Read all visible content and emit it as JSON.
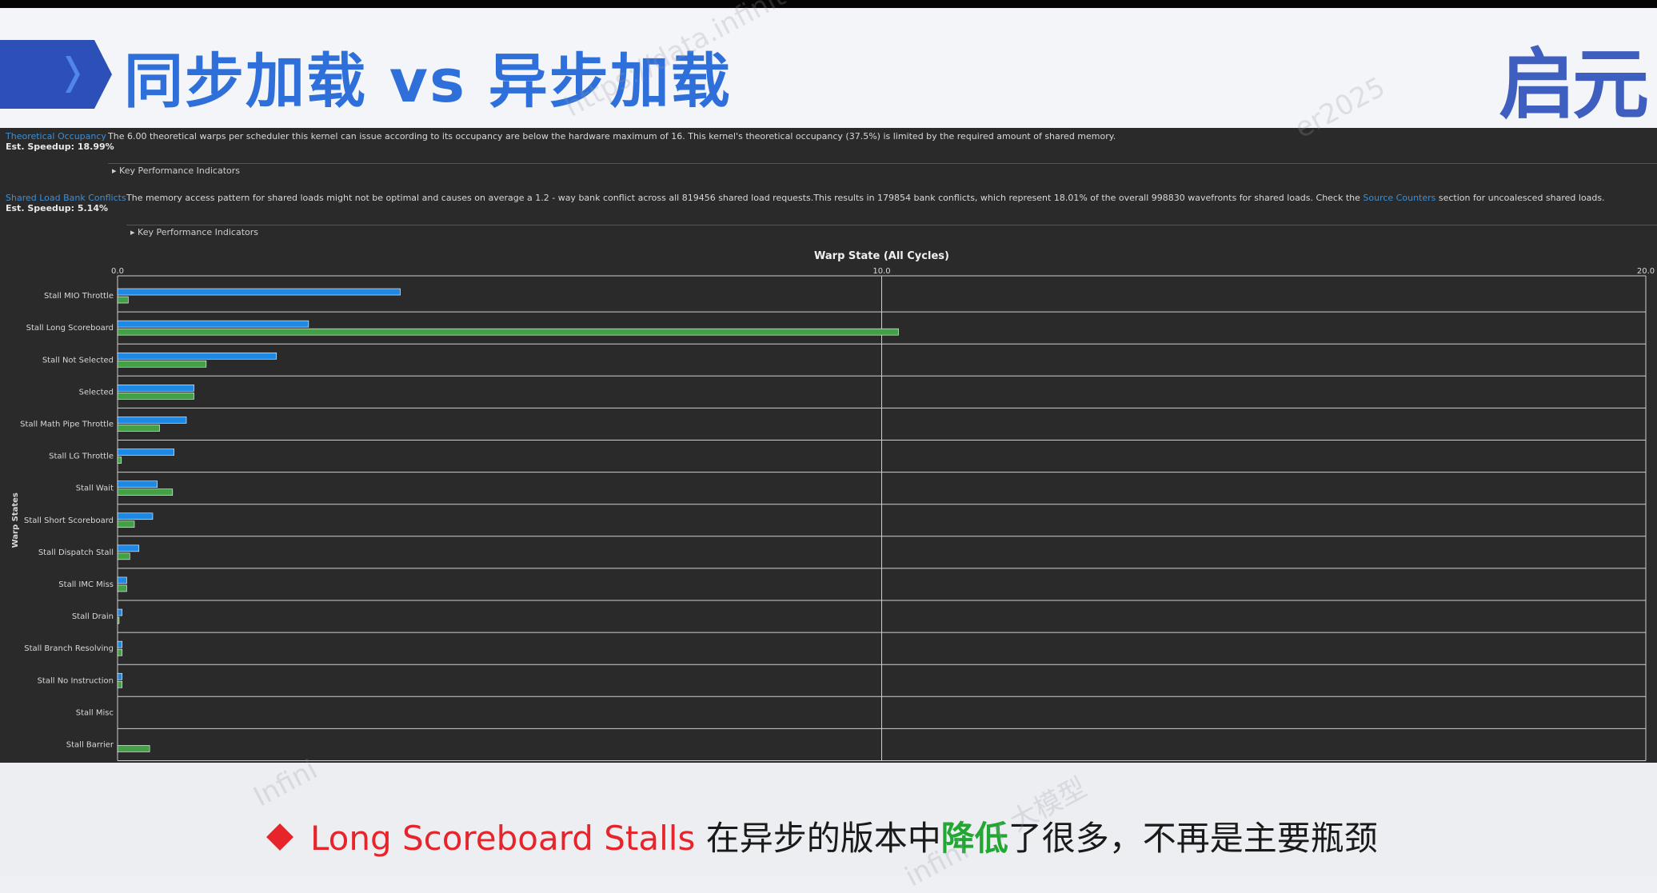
{
  "header": {
    "title": "同步加载 vs 异步加载",
    "logo": "启元"
  },
  "notes": [
    {
      "link": "Theoretical Occupancy",
      "speedup": "Est. Speedup: 18.99%",
      "text": "The 6.00 theoretical warps per scheduler this kernel can issue according to its occupancy are below the hardware maximum of 16. This kernel's theoretical occupancy (37.5%) is limited by the required amount of shared memory.",
      "kpi": "Key Performance Indicators"
    },
    {
      "link": "Shared Load Bank Conflicts",
      "speedup": "Est. Speedup: 5.14%",
      "text_before": "The memory access pattern for shared loads might not be optimal and causes on average a 1.2 - way bank conflict across all 819456 shared load requests.This results in 179854 bank conflicts, which represent 18.01% of the overall 998830 wavefronts for shared loads. Check the",
      "text_link": "Source Counters",
      "text_after": "section for uncoalesced shared loads.",
      "kpi": "Key Performance Indicators"
    }
  ],
  "chart_data": {
    "type": "bar",
    "orientation": "horizontal",
    "title": "Warp State (All Cycles)",
    "ylabel": "Warp States",
    "xlim": [
      0,
      20
    ],
    "xticks": [
      "0.0",
      "10.0",
      "20.0"
    ],
    "grid": true,
    "categories": [
      "Stall MIO Throttle",
      "Stall Long Scoreboard",
      "Stall Not Selected",
      "Selected",
      "Stall Math Pipe Throttle",
      "Stall LG Throttle",
      "Stall Wait",
      "Stall Short Scoreboard",
      "Stall Dispatch Stall",
      "Stall IMC Miss",
      "Stall Drain",
      "Stall Branch Resolving",
      "Stall No Instruction",
      "Stall Misc",
      "Stall Barrier"
    ],
    "series": [
      {
        "color": "#1e88e5",
        "values": [
          3.7,
          2.5,
          2.08,
          1.0,
          0.9,
          0.74,
          0.52,
          0.46,
          0.28,
          0.12,
          0.06,
          0.06,
          0.06,
          0.0,
          0.0
        ]
      },
      {
        "color": "#43a047",
        "values": [
          0.14,
          10.22,
          1.16,
          1.0,
          0.55,
          0.05,
          0.72,
          0.22,
          0.16,
          0.12,
          0.02,
          0.06,
          0.06,
          0.0,
          0.42
        ]
      }
    ]
  },
  "footer": {
    "prefix": "Long Scoreboard Stalls",
    "mid1": " 在异步的版本中",
    "highlight": "降低",
    "mid2": "了很多，不再是主要瓶颈"
  },
  "watermark": {
    "url": "https://data.infinite",
    "tail": "er2025",
    "left": "Infini",
    "mid": "r 大模型",
    "bottom": "infini"
  }
}
